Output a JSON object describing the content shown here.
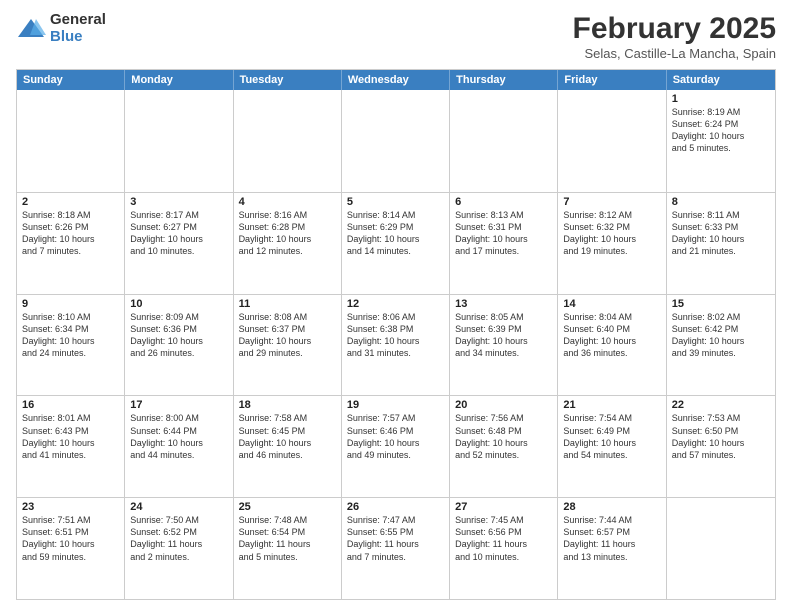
{
  "logo": {
    "general": "General",
    "blue": "Blue"
  },
  "header": {
    "month": "February 2025",
    "location": "Selas, Castille-La Mancha, Spain"
  },
  "weekdays": [
    "Sunday",
    "Monday",
    "Tuesday",
    "Wednesday",
    "Thursday",
    "Friday",
    "Saturday"
  ],
  "weeks": [
    [
      {
        "day": "",
        "text": ""
      },
      {
        "day": "",
        "text": ""
      },
      {
        "day": "",
        "text": ""
      },
      {
        "day": "",
        "text": ""
      },
      {
        "day": "",
        "text": ""
      },
      {
        "day": "",
        "text": ""
      },
      {
        "day": "1",
        "text": "Sunrise: 8:19 AM\nSunset: 6:24 PM\nDaylight: 10 hours\nand 5 minutes."
      }
    ],
    [
      {
        "day": "2",
        "text": "Sunrise: 8:18 AM\nSunset: 6:26 PM\nDaylight: 10 hours\nand 7 minutes."
      },
      {
        "day": "3",
        "text": "Sunrise: 8:17 AM\nSunset: 6:27 PM\nDaylight: 10 hours\nand 10 minutes."
      },
      {
        "day": "4",
        "text": "Sunrise: 8:16 AM\nSunset: 6:28 PM\nDaylight: 10 hours\nand 12 minutes."
      },
      {
        "day": "5",
        "text": "Sunrise: 8:14 AM\nSunset: 6:29 PM\nDaylight: 10 hours\nand 14 minutes."
      },
      {
        "day": "6",
        "text": "Sunrise: 8:13 AM\nSunset: 6:31 PM\nDaylight: 10 hours\nand 17 minutes."
      },
      {
        "day": "7",
        "text": "Sunrise: 8:12 AM\nSunset: 6:32 PM\nDaylight: 10 hours\nand 19 minutes."
      },
      {
        "day": "8",
        "text": "Sunrise: 8:11 AM\nSunset: 6:33 PM\nDaylight: 10 hours\nand 21 minutes."
      }
    ],
    [
      {
        "day": "9",
        "text": "Sunrise: 8:10 AM\nSunset: 6:34 PM\nDaylight: 10 hours\nand 24 minutes."
      },
      {
        "day": "10",
        "text": "Sunrise: 8:09 AM\nSunset: 6:36 PM\nDaylight: 10 hours\nand 26 minutes."
      },
      {
        "day": "11",
        "text": "Sunrise: 8:08 AM\nSunset: 6:37 PM\nDaylight: 10 hours\nand 29 minutes."
      },
      {
        "day": "12",
        "text": "Sunrise: 8:06 AM\nSunset: 6:38 PM\nDaylight: 10 hours\nand 31 minutes."
      },
      {
        "day": "13",
        "text": "Sunrise: 8:05 AM\nSunset: 6:39 PM\nDaylight: 10 hours\nand 34 minutes."
      },
      {
        "day": "14",
        "text": "Sunrise: 8:04 AM\nSunset: 6:40 PM\nDaylight: 10 hours\nand 36 minutes."
      },
      {
        "day": "15",
        "text": "Sunrise: 8:02 AM\nSunset: 6:42 PM\nDaylight: 10 hours\nand 39 minutes."
      }
    ],
    [
      {
        "day": "16",
        "text": "Sunrise: 8:01 AM\nSunset: 6:43 PM\nDaylight: 10 hours\nand 41 minutes."
      },
      {
        "day": "17",
        "text": "Sunrise: 8:00 AM\nSunset: 6:44 PM\nDaylight: 10 hours\nand 44 minutes."
      },
      {
        "day": "18",
        "text": "Sunrise: 7:58 AM\nSunset: 6:45 PM\nDaylight: 10 hours\nand 46 minutes."
      },
      {
        "day": "19",
        "text": "Sunrise: 7:57 AM\nSunset: 6:46 PM\nDaylight: 10 hours\nand 49 minutes."
      },
      {
        "day": "20",
        "text": "Sunrise: 7:56 AM\nSunset: 6:48 PM\nDaylight: 10 hours\nand 52 minutes."
      },
      {
        "day": "21",
        "text": "Sunrise: 7:54 AM\nSunset: 6:49 PM\nDaylight: 10 hours\nand 54 minutes."
      },
      {
        "day": "22",
        "text": "Sunrise: 7:53 AM\nSunset: 6:50 PM\nDaylight: 10 hours\nand 57 minutes."
      }
    ],
    [
      {
        "day": "23",
        "text": "Sunrise: 7:51 AM\nSunset: 6:51 PM\nDaylight: 10 hours\nand 59 minutes."
      },
      {
        "day": "24",
        "text": "Sunrise: 7:50 AM\nSunset: 6:52 PM\nDaylight: 11 hours\nand 2 minutes."
      },
      {
        "day": "25",
        "text": "Sunrise: 7:48 AM\nSunset: 6:54 PM\nDaylight: 11 hours\nand 5 minutes."
      },
      {
        "day": "26",
        "text": "Sunrise: 7:47 AM\nSunset: 6:55 PM\nDaylight: 11 hours\nand 7 minutes."
      },
      {
        "day": "27",
        "text": "Sunrise: 7:45 AM\nSunset: 6:56 PM\nDaylight: 11 hours\nand 10 minutes."
      },
      {
        "day": "28",
        "text": "Sunrise: 7:44 AM\nSunset: 6:57 PM\nDaylight: 11 hours\nand 13 minutes."
      },
      {
        "day": "",
        "text": ""
      }
    ]
  ]
}
